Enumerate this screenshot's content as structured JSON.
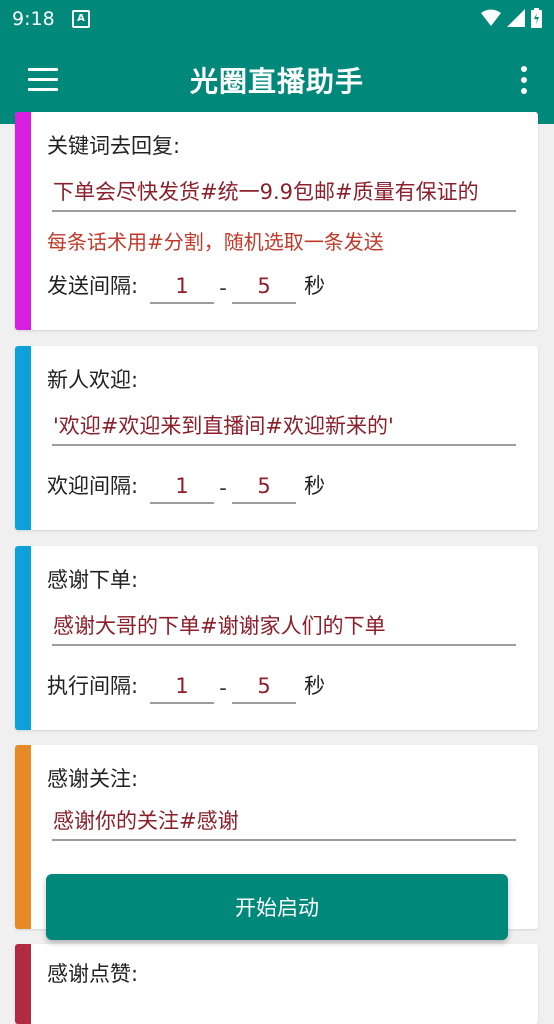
{
  "status": {
    "time": "9:18",
    "notif_icon": "A"
  },
  "app": {
    "title": "光圈直播助手"
  },
  "colors": {
    "teal": "#00897b",
    "magenta": "#d81ee0",
    "blue": "#0ea0d8",
    "orange": "#e58a25",
    "crimson": "#b22a40"
  },
  "cards": [
    {
      "label": "关键词去回复:",
      "field": "下单会尽快发货#统一9.9包邮#质量有保证的",
      "hint": "每条话术用#分割，随机选取一条发送",
      "interval_label": "发送间隔:",
      "min": "1",
      "dash": "-",
      "max": "5",
      "unit": "秒"
    },
    {
      "label": "新人欢迎:",
      "field": "'欢迎#欢迎来到直播间#欢迎新来的'",
      "interval_label": "欢迎间隔:",
      "min": "1",
      "dash": "-",
      "max": "5",
      "unit": "秒"
    },
    {
      "label": "感谢下单:",
      "field": "感谢大哥的下单#谢谢家人们的下单",
      "interval_label": "执行间隔:",
      "min": "1",
      "dash": "-",
      "max": "5",
      "unit": "秒"
    },
    {
      "label": "感谢关注:",
      "field": "感谢你的关注#感谢"
    },
    {
      "label": "感谢点赞:"
    }
  ],
  "start_button": "开始启动"
}
